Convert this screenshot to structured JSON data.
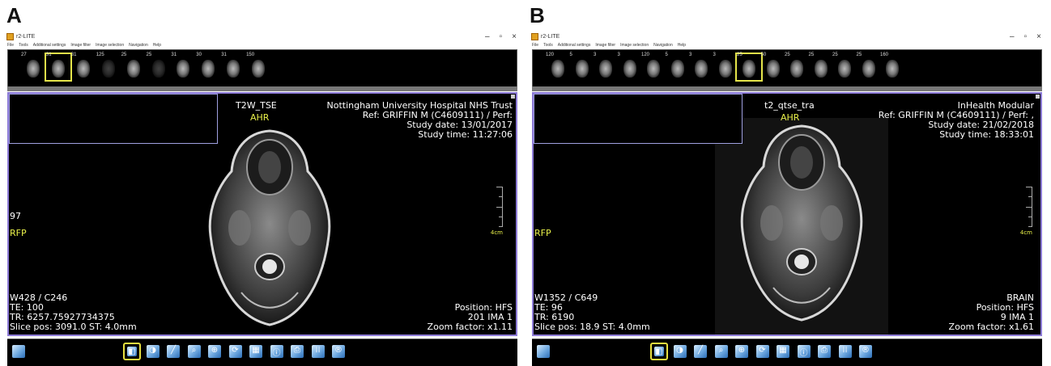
{
  "panels": [
    {
      "label": "A",
      "window_title": "r2-LITE",
      "menu": [
        "File",
        "Tools",
        "Additional settings",
        "Image filter",
        "Image selection",
        "Navigation",
        "Help"
      ],
      "thumbnails": [
        {
          "num": "27",
          "sel": false,
          "dim": false
        },
        {
          "num": "31",
          "sel": true,
          "dim": false
        },
        {
          "num": "31",
          "sel": false,
          "dim": false
        },
        {
          "num": "125",
          "sel": false,
          "dim": true
        },
        {
          "num": "25",
          "sel": false,
          "dim": false
        },
        {
          "num": "25",
          "sel": false,
          "dim": true
        },
        {
          "num": "31",
          "sel": false,
          "dim": false
        },
        {
          "num": "30",
          "sel": false,
          "dim": false
        },
        {
          "num": "31",
          "sel": false,
          "dim": false
        },
        {
          "num": "150",
          "sel": false,
          "dim": false
        }
      ],
      "series_name": "T2W_TSE",
      "orient_top": "AHR",
      "orient_left": "RFP",
      "slice_index": "97",
      "hospital": "Nottingham University Hospital NHS Trust",
      "ref": "Ref: GRIFFIN M (C4609111) / Perf:",
      "study_date": "Study date: 13/01/2017",
      "study_time": "Study time: 11:27:06",
      "scale": "4cm",
      "window_level": "W428 / C246",
      "te": "TE: 100",
      "tr": "TR: 6257.75927734375",
      "slice_pos": "Slice pos: 3091.0  ST: 4.0mm",
      "body_part": "",
      "position": "Position: HFS",
      "ima": "201 IMA 1",
      "zoom": "Zoom factor: x1.11",
      "selected_tools": [
        0,
        7
      ]
    },
    {
      "label": "B",
      "window_title": "r2-LITE",
      "menu": [
        "File",
        "Tools",
        "Additional settings",
        "Image filter",
        "Image selection",
        "Navigation",
        "Help"
      ],
      "thumbnails": [
        {
          "num": "120",
          "sel": false,
          "dim": false
        },
        {
          "num": "5",
          "sel": false,
          "dim": false
        },
        {
          "num": "3",
          "sel": false,
          "dim": false
        },
        {
          "num": "3",
          "sel": false,
          "dim": false
        },
        {
          "num": "120",
          "sel": false,
          "dim": false
        },
        {
          "num": "5",
          "sel": false,
          "dim": false
        },
        {
          "num": "3",
          "sel": false,
          "dim": false
        },
        {
          "num": "3",
          "sel": false,
          "dim": false
        },
        {
          "num": "25",
          "sel": true,
          "dim": false
        },
        {
          "num": "50",
          "sel": false,
          "dim": false
        },
        {
          "num": "25",
          "sel": false,
          "dim": false
        },
        {
          "num": "25",
          "sel": false,
          "dim": false
        },
        {
          "num": "25",
          "sel": false,
          "dim": false
        },
        {
          "num": "25",
          "sel": false,
          "dim": false
        },
        {
          "num": "160",
          "sel": false,
          "dim": false
        }
      ],
      "series_name": "t2_qtse_tra",
      "orient_top": "AHR",
      "orient_left": "RFP",
      "slice_index": "",
      "hospital": "InHealth Modular",
      "ref": "Ref: GRIFFIN M (C4609111) / Perf: ,",
      "study_date": "Study date: 21/02/2018",
      "study_time": "Study time: 18:33:01",
      "scale": "4cm",
      "window_level": "W1352 / C649",
      "te": "TE: 96",
      "tr": "TR: 6190",
      "slice_pos": "Slice pos: 18.9  ST: 4.0mm",
      "body_part": "BRAIN",
      "position": "Position: HFS",
      "ima": "9 IMA 1",
      "zoom": "Zoom factor: x1.61",
      "selected_tools": [
        0,
        7
      ]
    }
  ],
  "toolbar_icons": [
    "pan-icon",
    "window-level-icon",
    "contrast-icon",
    "measure-line-icon",
    "zoom-icon",
    "zoom-region-icon",
    "rotate-icon",
    "grid-icon",
    "text-info-icon",
    "print-icon",
    "layout-icon",
    "reset-icon"
  ],
  "toolbar_glyphs": [
    "✥",
    "◧",
    "◑",
    "╱",
    "⌕",
    "⊕",
    "⟳",
    "▦",
    "ⓘ",
    "⎙",
    "⁞⁞",
    "®"
  ]
}
